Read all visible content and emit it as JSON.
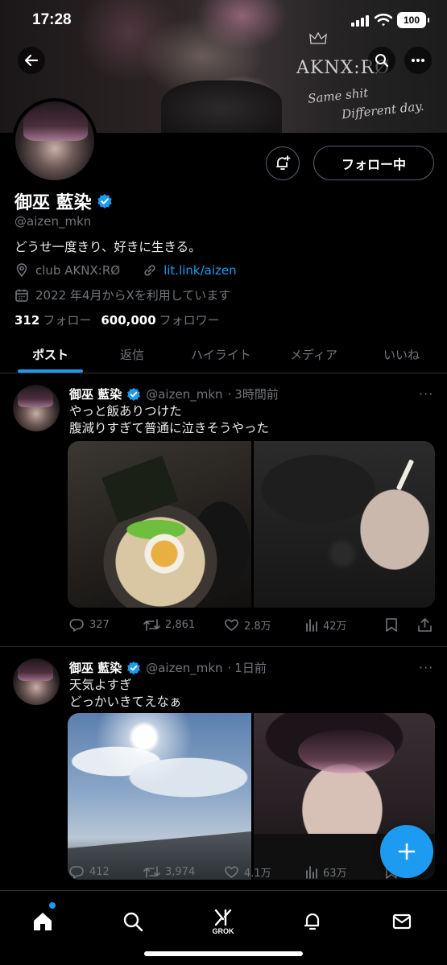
{
  "status_bar": {
    "time": "17:28",
    "battery": "100"
  },
  "banner": {
    "logo_text": "AKNX:RØ",
    "tagline_1": "Same shit",
    "tagline_2": "Different day."
  },
  "profile": {
    "name": "御巫 藍染",
    "handle": "@aizen_mkn",
    "bio": "どうせ一度きり、好きに生きる。",
    "location": "club AKNX:RØ",
    "link": "lit.link/aizen",
    "joined": "2022 年4月からXを利用しています",
    "following_count": "312",
    "following_label": "フォロー",
    "followers_count": "600,000",
    "followers_label": "フォロワー",
    "follow_button": "フォロー中"
  },
  "tabs": [
    {
      "label": "ポスト",
      "active": true
    },
    {
      "label": "返信",
      "active": false
    },
    {
      "label": "ハイライト",
      "active": false
    },
    {
      "label": "メディア",
      "active": false
    },
    {
      "label": "いいね",
      "active": false
    }
  ],
  "posts": [
    {
      "name": "御巫 藍染",
      "handle": "@aizen_mkn",
      "time": "3時間前",
      "line1": "やっと飯ありつけた",
      "line2": "腹減りすぎて普通に泣きそうやった",
      "replies": "327",
      "reposts": "2,861",
      "likes": "2.8万",
      "views": "42万"
    },
    {
      "name": "御巫 藍染",
      "handle": "@aizen_mkn",
      "time": "1日前",
      "line1": "天気よすぎ",
      "line2": "どっかいきてえなぁ",
      "replies": "412",
      "reposts": "3,974",
      "likes": "4.1万",
      "views": "63万"
    }
  ],
  "nav": {
    "grok_label": "GROK"
  },
  "colors": {
    "accent": "#1d9bf0",
    "background": "#000000",
    "muted": "#71767b"
  }
}
